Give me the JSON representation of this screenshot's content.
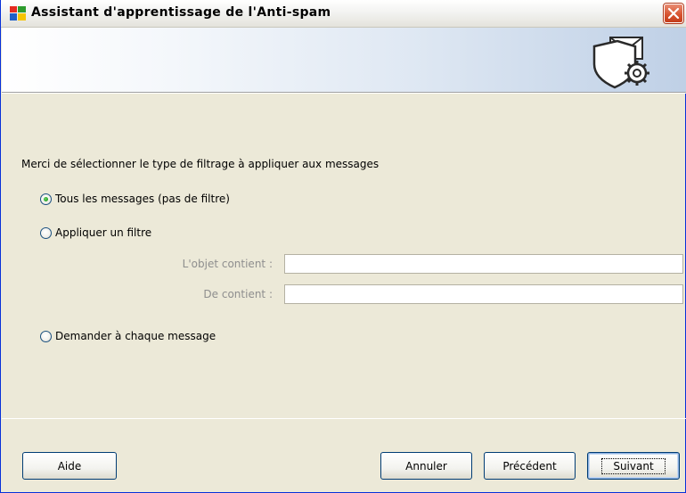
{
  "window": {
    "title": "Assistant d'apprentissage de l'Anti-spam",
    "app_icon": "avg-logo-icon",
    "close_icon": "close-icon"
  },
  "header": {
    "icon": "shield-envelope-gear-icon"
  },
  "main": {
    "instruction": "Merci de sélectionner le type de filtrage à appliquer aux messages",
    "options": [
      {
        "label": "Tous les messages (pas de filtre)",
        "checked": true
      },
      {
        "label": "Appliquer un filtre",
        "checked": false
      },
      {
        "label": "Demander à chaque message",
        "checked": false
      }
    ],
    "filter_fields": {
      "subject_label": "L'objet contient :",
      "subject_value": "",
      "from_label": "De contient :",
      "from_value": ""
    }
  },
  "footer": {
    "help_label": "Aide",
    "cancel_label": "Annuler",
    "previous_label": "Précédent",
    "next_label": "Suivant"
  },
  "colors": {
    "dialog_bg": "#ece9d8",
    "selected_radio": "#21a121",
    "banner_accent": "#bfd0e6"
  }
}
